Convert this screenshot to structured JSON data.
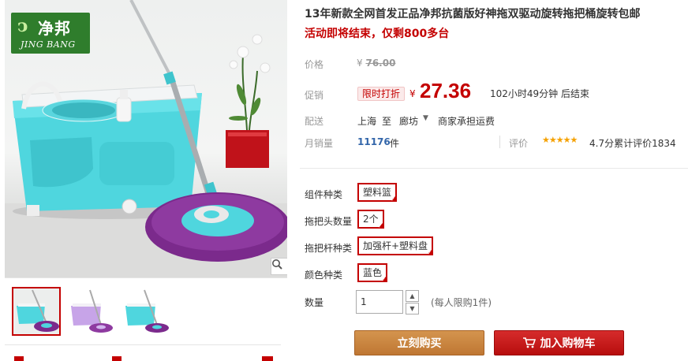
{
  "brand_logo": {
    "text_cn": "净邦",
    "text_en": "JING BANG"
  },
  "product": {
    "title": "13年新款全网首发正品净邦抗菌版好神拖双驱动旋转拖把桶旋转包邮",
    "subtitle": "活动即将结束，仅剩800多台"
  },
  "price": {
    "label": "价格",
    "currency": "¥",
    "original": "76.00"
  },
  "promo": {
    "label": "促销",
    "tag": "限时打折",
    "currency": "¥",
    "price": "27.36",
    "countdown": "102小时49分钟 后结束"
  },
  "shipping": {
    "label": "配送",
    "from": "上海",
    "to_word": "至",
    "to": "廊坊",
    "fee": "商家承担运费"
  },
  "sales": {
    "label": "月销量",
    "count": "11176",
    "unit": "件",
    "rating_label": "评价",
    "stars": "★★★★★",
    "rating_value": 4.7,
    "rating_text": "4.7分累计评价1834"
  },
  "options": [
    {
      "label": "组件种类",
      "selected": "塑料篮"
    },
    {
      "label": "拖把头数量",
      "selected": "2个"
    },
    {
      "label": "拖把杆种类",
      "selected": "加强杆+塑料盘"
    },
    {
      "label": "颜色种类",
      "selected": "蓝色"
    }
  ],
  "quantity": {
    "label": "数量",
    "value": "1",
    "limit": "(每人限购1件)"
  },
  "buttons": {
    "buy_now": "立刻购买",
    "add_to_cart": "加入购物车"
  },
  "colors": {
    "accent_red": "#c40000",
    "buy_orange": "#c78240",
    "link_blue": "#3366aa",
    "star_gold": "#f5a100",
    "bucket_cyan": "#4fd6de",
    "mop_purple": "#7b2a8c"
  },
  "icons": [
    "search-zoom-icon",
    "cart-icon",
    "corner-check-icon",
    "chevron-up-icon",
    "chevron-down-icon",
    "caret-down-icon"
  ]
}
